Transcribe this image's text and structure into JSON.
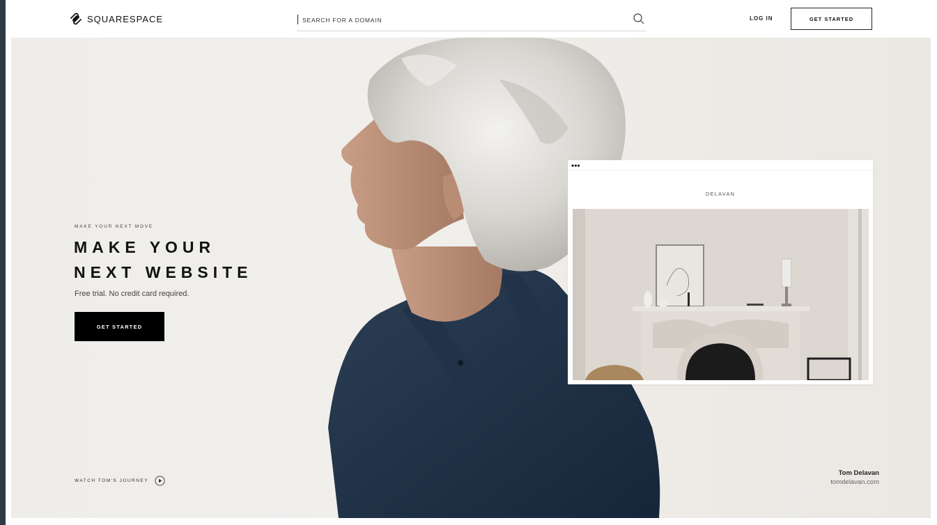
{
  "header": {
    "logo_text": "SQUARESPACE",
    "search_placeholder": "SEARCH FOR A DOMAIN",
    "login_label": "LOG IN",
    "get_started_label": "GET STARTED"
  },
  "hero": {
    "eyebrow": "MAKE YOUR NEXT MOVE",
    "headline_line1": "MAKE YOUR",
    "headline_line2": "NEXT WEBSITE",
    "subtext": "Free trial. No credit card required.",
    "cta_label": "GET STARTED",
    "journey_label": "WATCH TOM'S JOURNEY",
    "caption_name": "Tom Delavan",
    "caption_url": "tomdelavan.com"
  },
  "mock_site": {
    "dots": "•••",
    "title": "DELAVAN"
  },
  "colors": {
    "accent": "#000000",
    "hero_bg": "#efedea",
    "shirt": "#1f3146",
    "hair": "#d9d7d2"
  },
  "icons": {
    "logo": "squarespace-logo-icon",
    "search": "search-icon",
    "play": "play-circle-icon"
  }
}
